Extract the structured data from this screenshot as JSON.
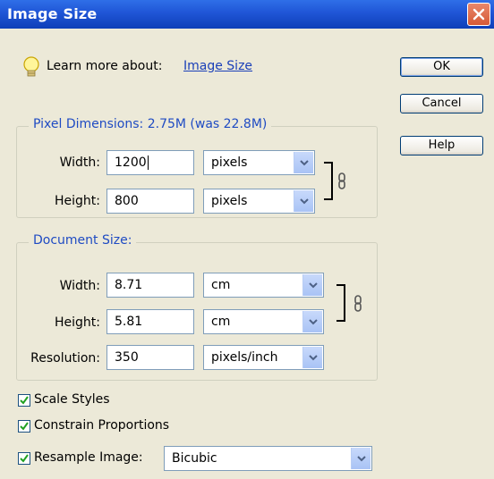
{
  "window": {
    "title": "Image Size"
  },
  "learn_more": {
    "prefix": "Learn more about:",
    "link": "Image Size"
  },
  "buttons": {
    "ok": "OK",
    "cancel": "Cancel",
    "help": "Help"
  },
  "pixel_dimensions": {
    "legend": "Pixel Dimensions:  2.75M (was 22.8M)",
    "width_label": "Width:",
    "width_value": "1200",
    "width_unit": "pixels",
    "height_label": "Height:",
    "height_value": "800",
    "height_unit": "pixels"
  },
  "document_size": {
    "legend": "Document Size:",
    "width_label": "Width:",
    "width_value": "8.71",
    "width_unit": "cm",
    "height_label": "Height:",
    "height_value": "5.81",
    "height_unit": "cm",
    "resolution_label": "Resolution:",
    "resolution_value": "350",
    "resolution_unit": "pixels/inch"
  },
  "options": {
    "scale_styles": "Scale Styles",
    "constrain_proportions": "Constrain Proportions",
    "resample_image": "Resample Image:",
    "resample_method": "Bicubic"
  },
  "colors": {
    "title_bar": "#1f55d6",
    "legend_text": "#1f4bc3",
    "link": "#1a3fb8"
  }
}
